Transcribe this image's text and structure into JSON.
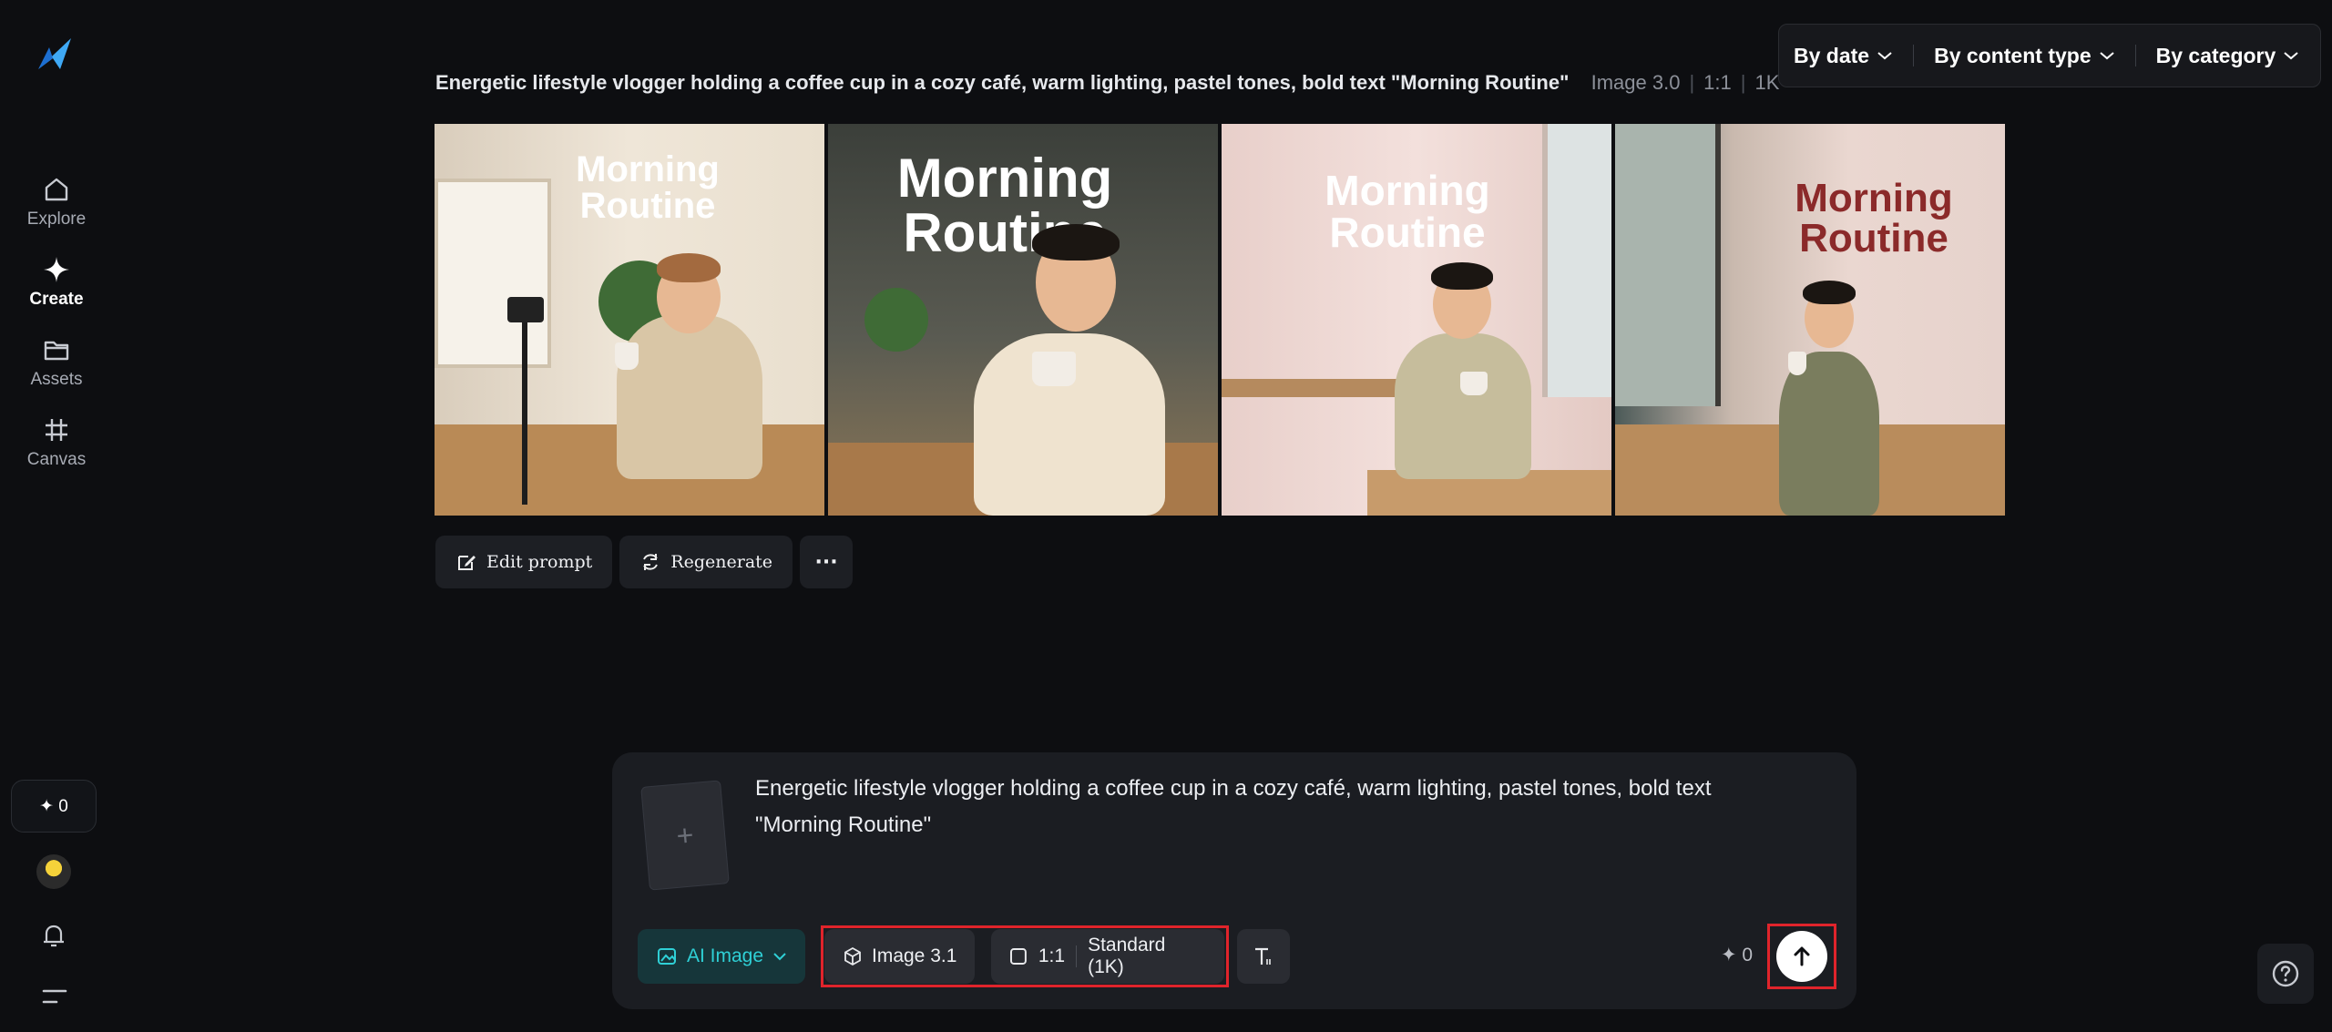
{
  "sidebar": {
    "items": [
      {
        "label": "Explore",
        "icon": "home-icon"
      },
      {
        "label": "Create",
        "icon": "sparkle-icon"
      },
      {
        "label": "Assets",
        "icon": "folder-icon"
      },
      {
        "label": "Canvas",
        "icon": "canvas-icon"
      }
    ],
    "credits": "✦ 0"
  },
  "filters": {
    "by_date": "By date",
    "by_content_type": "By content type",
    "by_category": "By category"
  },
  "generation": {
    "prompt": "Energetic lifestyle vlogger holding a coffee cup in a cozy café, warm lighting, pastel tones, bold text \"Morning Routine\"",
    "model": "Image 3.0",
    "ratio": "1:1",
    "resolution": "1K",
    "image_title": "Morning Routine",
    "image_title_lines": [
      "Morning",
      "Routine"
    ]
  },
  "actions": {
    "edit_prompt": "Edit prompt",
    "regenerate": "Regenerate",
    "more": "···"
  },
  "composer": {
    "prompt_text": "Energetic lifestyle vlogger holding a coffee cup in a cozy café, warm lighting, pastel tones, bold text \"Morning Routine\"",
    "upload_glyph": "+",
    "mode_label": "AI Image",
    "model_label": "Image 3.1",
    "ratio_label": "1:1",
    "quality_label": "Standard (1K)",
    "cost": "✦ 0"
  },
  "colors": {
    "accent_teal": "#2fd0d6",
    "highlight_red": "#e0242b",
    "background": "#0d0e11"
  }
}
